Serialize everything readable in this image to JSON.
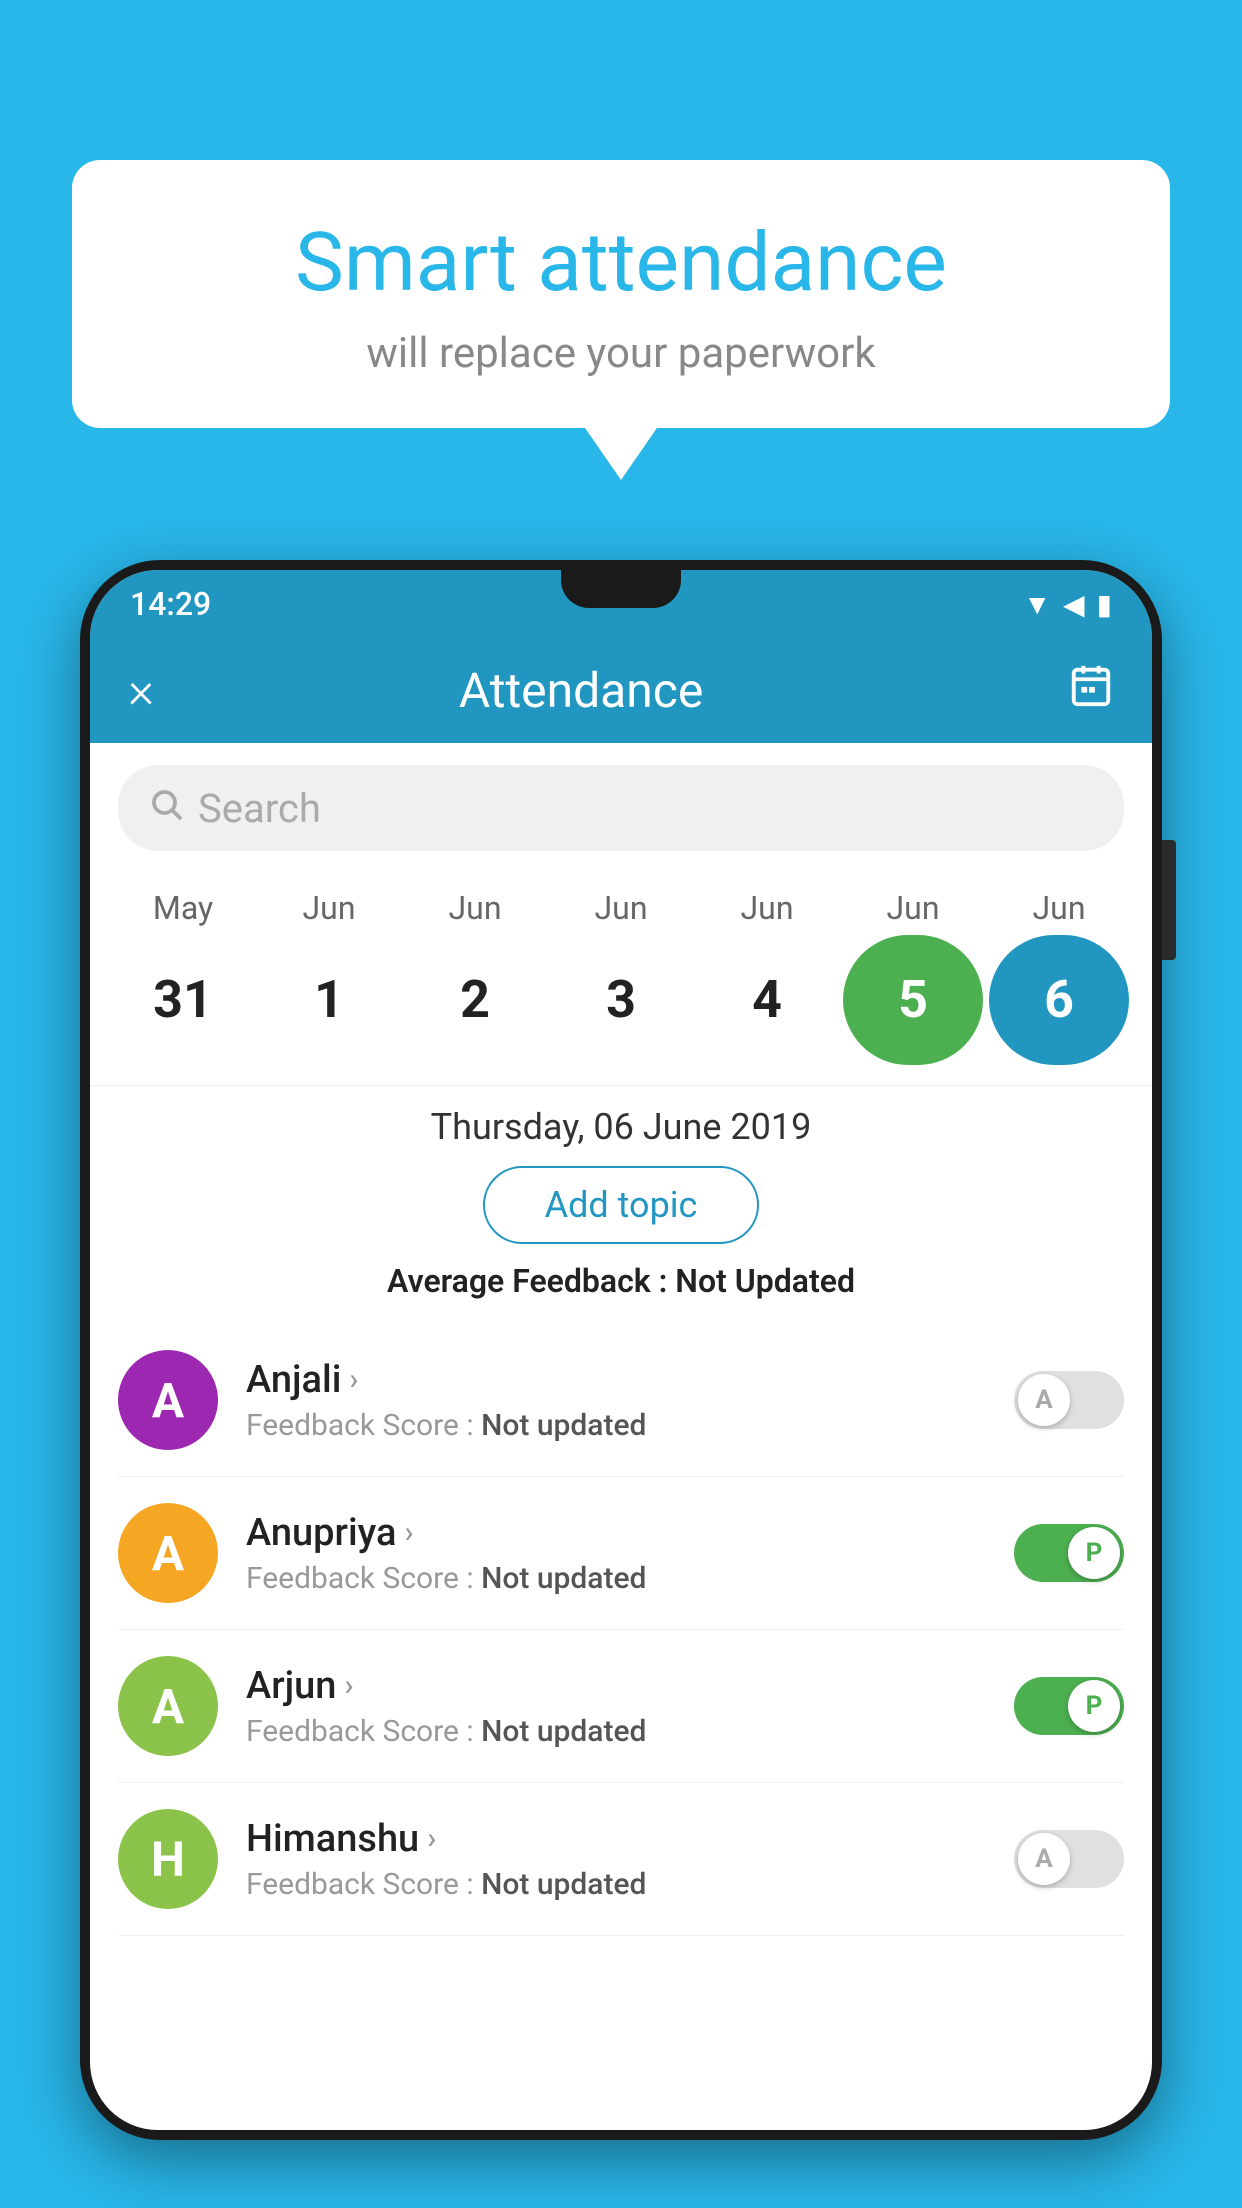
{
  "background": {
    "color": "#29b6e8"
  },
  "speech_bubble": {
    "title": "Smart attendance",
    "subtitle": "will replace your paperwork"
  },
  "phone": {
    "status_bar": {
      "time": "14:29",
      "icons": [
        "wifi",
        "signal",
        "battery"
      ]
    },
    "app_bar": {
      "title": "Attendance",
      "close_icon": "×",
      "calendar_icon": "📅"
    },
    "search": {
      "placeholder": "Search"
    },
    "calendar": {
      "months": [
        "May",
        "Jun",
        "Jun",
        "Jun",
        "Jun",
        "Jun",
        "Jun"
      ],
      "dates": [
        "31",
        "1",
        "2",
        "3",
        "4",
        "5",
        "6"
      ],
      "states": [
        "normal",
        "normal",
        "normal",
        "normal",
        "normal",
        "today",
        "selected"
      ]
    },
    "date_display": {
      "full": "Thursday, 06 June 2019",
      "add_topic_label": "Add topic",
      "avg_feedback_label": "Average Feedback :",
      "avg_feedback_value": "Not Updated"
    },
    "students": [
      {
        "name": "Anjali",
        "initial": "A",
        "avatar_color": "#9c27b0",
        "feedback_label": "Feedback Score :",
        "feedback_value": "Not updated",
        "toggle_state": "off",
        "toggle_label": "A"
      },
      {
        "name": "Anupriya",
        "initial": "A",
        "avatar_color": "#f5a623",
        "feedback_label": "Feedback Score :",
        "feedback_value": "Not updated",
        "toggle_state": "on",
        "toggle_label": "P"
      },
      {
        "name": "Arjun",
        "initial": "A",
        "avatar_color": "#8bc34a",
        "feedback_label": "Feedback Score :",
        "feedback_value": "Not updated",
        "toggle_state": "on",
        "toggle_label": "P"
      },
      {
        "name": "Himanshu",
        "initial": "H",
        "avatar_color": "#8bc34a",
        "feedback_label": "Feedback Score :",
        "feedback_value": "Not updated",
        "toggle_state": "off",
        "toggle_label": "A"
      }
    ]
  }
}
